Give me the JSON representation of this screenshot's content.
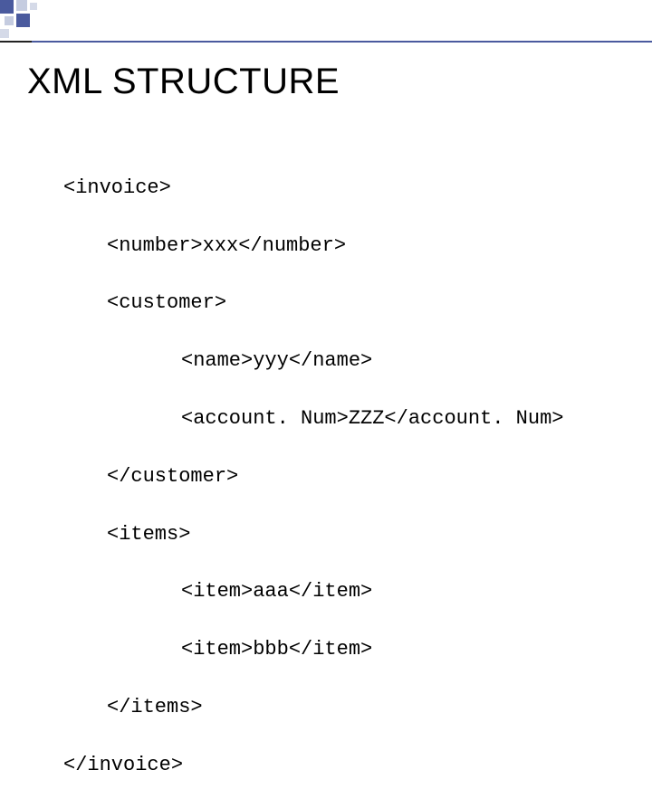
{
  "slide": {
    "title": "XML STRUCTURE",
    "code": {
      "line1": "<invoice>",
      "line2": "<number>xxx</number>",
      "line3": "<customer>",
      "line4": "<name>yyy</name>",
      "line5": "<account. Num>ZZZ</account. Num>",
      "line6": "</customer>",
      "line7": "<items>",
      "line8": "<item>aaa</item>",
      "line9": "<item>bbb</item>",
      "line10": "</items>",
      "line11": "</invoice>"
    }
  }
}
